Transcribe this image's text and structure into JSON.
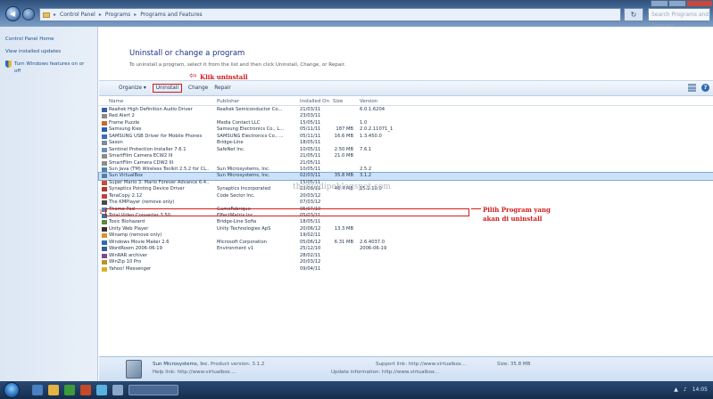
{
  "window": {
    "breadcrumbs": [
      "Control Panel",
      "Programs",
      "Programs and Features"
    ],
    "search_placeholder": "Search Programs and Features"
  },
  "left_pane": {
    "links": [
      "Control Panel Home",
      "View installed updates",
      "Turn Windows features on or off"
    ]
  },
  "main": {
    "heading": "Uninstall or change a program",
    "description": "To uninstall a program, select it from the list and then click Uninstall, Change, or Repair.",
    "toolbar": {
      "organize": "Organize",
      "uninstall": "Uninstall",
      "change": "Change",
      "repair": "Repair"
    },
    "columns": {
      "name": "Name",
      "publisher": "Publisher",
      "installed_on": "Installed On",
      "size": "Size",
      "version": "Version"
    }
  },
  "programs": [
    {
      "name": "Realtek High Definition Audio Driver",
      "publisher": "Realtek Semiconductor Co...",
      "installed": "21/03/11",
      "size": "",
      "version": "6.0.1.6204",
      "icon_color": "#3b5ea8"
    },
    {
      "name": "Red Alert 2",
      "publisher": "",
      "installed": "23/03/11",
      "size": "",
      "version": "",
      "icon_color": "#8a8a8a"
    },
    {
      "name": "Frame Puzzle",
      "publisher": "Media Contact LLC",
      "installed": "15/05/11",
      "size": "",
      "version": "1.0",
      "icon_color": "#c9692f"
    },
    {
      "name": "Samsung Kies",
      "publisher": "Samsung Electronics Co., L...",
      "installed": "05/11/11",
      "size": "187 MB",
      "version": "2.0.2.11071_1",
      "icon_color": "#2a5fb0"
    },
    {
      "name": "SAMSUNG USB Driver for Mobile Phones",
      "publisher": "SAMSUNG Electronics Co., ...",
      "installed": "05/11/11",
      "size": "16.6 MB",
      "version": "1.3.450.0",
      "icon_color": "#3a6bc4"
    },
    {
      "name": "Saxon",
      "publisher": "Bridge-Line",
      "installed": "18/05/11",
      "size": "",
      "version": "",
      "icon_color": "#7a8b9c"
    },
    {
      "name": "Sentinel Protection Installer 7.6.1",
      "publisher": "SafeNet Inc.",
      "installed": "10/05/11",
      "size": "2.50 MB",
      "version": "7.6.1",
      "icon_color": "#6c8fb8"
    },
    {
      "name": "SmartFilm Camera ECW2 III",
      "publisher": "",
      "installed": "21/05/11",
      "size": "21.0 MB",
      "version": "",
      "icon_color": "#8c8c8c"
    },
    {
      "name": "SmartFilm Camera CDW2 III",
      "publisher": "",
      "installed": "21/05/11",
      "size": "",
      "version": "",
      "icon_color": "#8c8c8c"
    },
    {
      "name": "Sun Java (TM) Wireless Toolkit 2.5.2 for CL...",
      "publisher": "Sun Microsystems, Inc.",
      "installed": "10/05/11",
      "size": "",
      "version": "2.5.2",
      "icon_color": "#4f7fb4"
    },
    {
      "name": "Sun VirtualBox",
      "publisher": "Sun Microsystems, Inc.",
      "installed": "02/03/11",
      "size": "35.8 MB",
      "version": "3.1.2",
      "icon_color": "#5b7ea3"
    },
    {
      "name": "Super Mario 3: Mario Forever Advance 6.4...",
      "publisher": "",
      "installed": "15/05/11",
      "size": "",
      "version": "",
      "icon_color": "#d14a2b"
    },
    {
      "name": "Synaptics Pointing Device Driver",
      "publisher": "Synaptics Incorporated",
      "installed": "23/03/11",
      "size": "46.4 MB",
      "version": "15.2.10.0",
      "icon_color": "#b43434"
    },
    {
      "name": "TeraCopy 2.12",
      "publisher": "Code Sector Inc.",
      "installed": "20/03/12",
      "size": "",
      "version": "",
      "icon_color": "#c93c3c"
    },
    {
      "name": "The KMPlayer (remove only)",
      "publisher": "",
      "installed": "07/03/12",
      "size": "",
      "version": "",
      "icon_color": "#4a4a4a"
    },
    {
      "name": "Thomo Pad",
      "publisher": "GameFabrique",
      "installed": "05/07/10",
      "size": "",
      "version": "",
      "icon_color": "#5a7fa8"
    },
    {
      "name": "Total Video Converter 3.50",
      "publisher": "EffectMatrix Inc.",
      "installed": "05/03/11",
      "size": "",
      "version": "",
      "icon_color": "#3c6e9a"
    },
    {
      "name": "Toxic Biohazard",
      "publisher": "Bridge-Line Sofia",
      "installed": "18/05/11",
      "size": "",
      "version": "",
      "icon_color": "#5a8b3a"
    },
    {
      "name": "Unity Web Player",
      "publisher": "Unity Technologies ApS",
      "installed": "20/06/12",
      "size": "13.3 MB",
      "version": "",
      "icon_color": "#333333"
    },
    {
      "name": "Winamp (remove only)",
      "publisher": "",
      "installed": "19/02/11",
      "size": "",
      "version": "",
      "icon_color": "#e0902b"
    },
    {
      "name": "Windows Movie Maker 2.6",
      "publisher": "Microsoft Corporation",
      "installed": "05/06/12",
      "size": "6.31 MB",
      "version": "2.6.4037.0",
      "icon_color": "#2e6bb5"
    },
    {
      "name": "WordRoom 2006-06-19",
      "publisher": "Environment v1",
      "installed": "25/12/10",
      "size": "",
      "version": "2006-06-19",
      "icon_color": "#3a5f8c"
    },
    {
      "name": "WinRAR archiver",
      "publisher": "",
      "installed": "28/02/11",
      "size": "",
      "version": "",
      "icon_color": "#7a4a8c"
    },
    {
      "name": "WinZip 10 Pro",
      "publisher": "",
      "installed": "20/03/12",
      "size": "",
      "version": "",
      "icon_color": "#b4942a"
    },
    {
      "name": "Yahoo! Messenger",
      "publisher": "",
      "installed": "09/04/11",
      "size": "",
      "version": "",
      "icon_color": "#d8b12a"
    }
  ],
  "selected_index": 10,
  "details": {
    "publisher": "Sun Microsystems, Inc.",
    "product_version": "Product version: 3.1.2",
    "help_link": "Help link: http://www.virtualbox....",
    "support_link": "Support link: http://www.virtualbox...",
    "update_info": "Update information: http://www.virtualbox...",
    "size": "Size: 35.8 MB"
  },
  "annotations": {
    "klik": "Klik uninstall",
    "pilih_line1": "Pilih Program yang",
    "pilih_line2": "akan di uninstall",
    "number": "1",
    "watermark": "therzadipeblogspot.com"
  },
  "tray": {
    "time": "14:05"
  },
  "colors": {
    "accent_red": "#d21c1c",
    "selection": "#cde2f8"
  }
}
